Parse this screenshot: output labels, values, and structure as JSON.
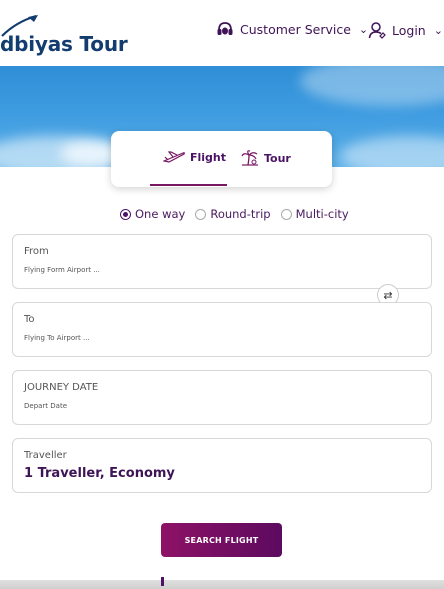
{
  "header": {
    "logo_text": "dbiyas Tour",
    "customer_service_label": "Customer Service",
    "login_label": "Login"
  },
  "tabs": {
    "flight_label": "Flight",
    "tour_label": "Tour",
    "active": "Flight"
  },
  "trip_type": {
    "options": [
      "One way",
      "Round-trip",
      "Multi-city"
    ],
    "selected": "One way"
  },
  "form": {
    "from": {
      "label": "From",
      "placeholder": "Flying Form Airport ..."
    },
    "to": {
      "label": "To",
      "placeholder": "Flying To Airport ..."
    },
    "journey_date": {
      "label": "JOURNEY DATE",
      "placeholder": "Depart Date"
    },
    "traveller": {
      "label": "Traveller",
      "value": "1 Traveller, Economy"
    }
  },
  "search_button_label": "SEARCH FLIGHT",
  "colors": {
    "brand_purple": "#4b1366",
    "button_start": "#8d1266",
    "button_end": "#5c0a5f",
    "logo_blue": "#123d6e",
    "sky": "#3d9be0"
  },
  "icons": [
    "plane-logo-icon",
    "headset-icon",
    "user-icon",
    "chevron-down-icon",
    "airplane-icon",
    "palm-tree-icon",
    "swap-icon"
  ]
}
